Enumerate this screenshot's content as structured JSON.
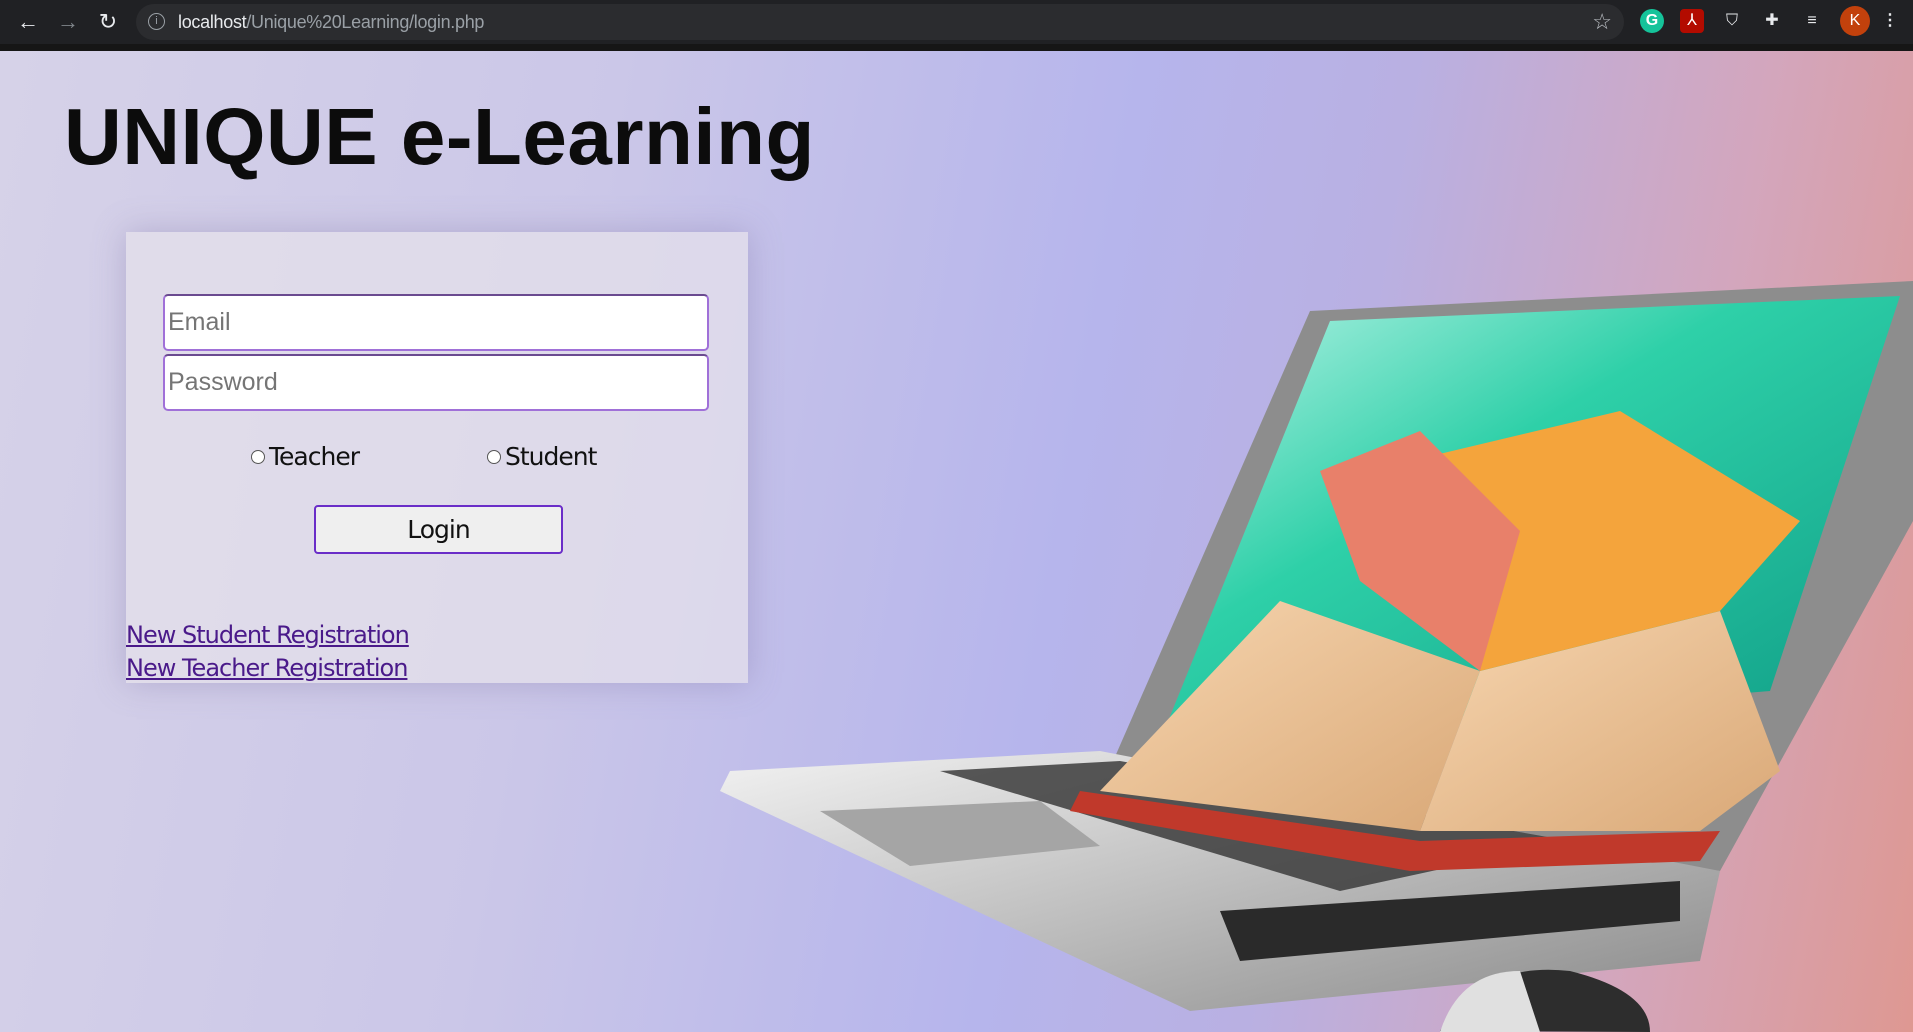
{
  "browser": {
    "url_host": "localhost",
    "url_path": "/Unique%20Learning/login.php",
    "profile_initial": "K"
  },
  "page": {
    "title": "UNIQUE e-Learning",
    "email_placeholder": "Email",
    "password_placeholder": "Password",
    "roles": [
      "Teacher",
      "Student"
    ],
    "login_label": "Login",
    "links": [
      "New Student Registration",
      "New Teacher Registration"
    ]
  },
  "colors": {
    "accent": "#6a2dc8",
    "link": "#4a1a8a"
  }
}
